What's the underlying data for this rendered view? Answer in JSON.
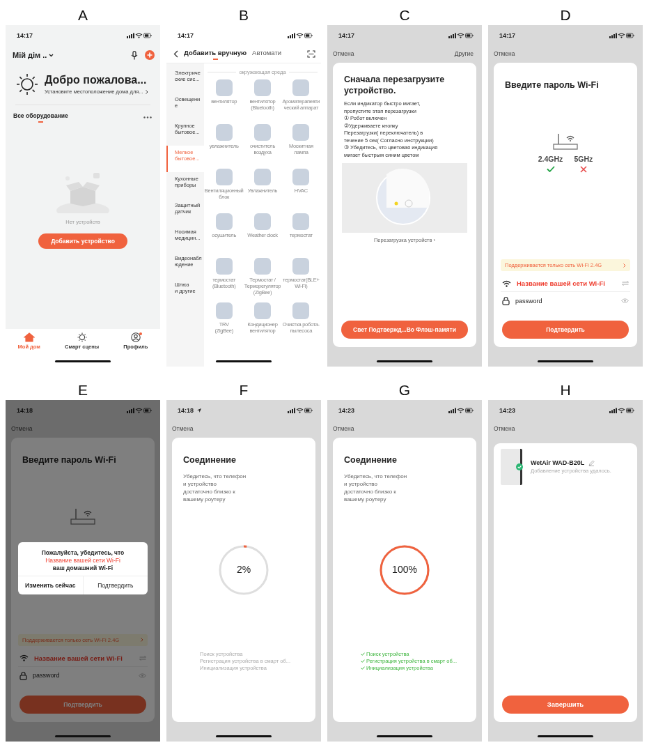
{
  "panels": [
    {
      "label": "A",
      "kind": "home",
      "time": "14:17",
      "home_name": "Мій дім ..",
      "welcome_title": "Добро пожалова...",
      "welcome_subtitle": "Установите местоположение дома для...",
      "section_tab": {
        "label": "Все оборудование",
        "selected": true
      },
      "empty_text": "Нет устройств",
      "add_button": "Добавить устройство",
      "nav": [
        {
          "label": "Мой дом",
          "selected": true,
          "badge": false
        },
        {
          "label": "Смарт сцены",
          "selected": false,
          "badge": false
        },
        {
          "label": "Профиль",
          "selected": false,
          "badge": true
        }
      ]
    },
    {
      "label": "B",
      "kind": "add",
      "time": "14:17",
      "tabs": [
        {
          "label": "Добавить вручную",
          "selected": true
        },
        {
          "label": "Автомати",
          "selected": false
        }
      ],
      "categories": [
        {
          "label": "Электриче\nские сис...",
          "selected": false
        },
        {
          "label": "Освещени\nе",
          "selected": false
        },
        {
          "label": "Крупное\nбытовое...",
          "selected": false
        },
        {
          "label": "Мелкое\nбытовое...",
          "selected": true
        },
        {
          "label": "Кухонные\nприборы",
          "selected": false
        },
        {
          "label": "Защитный\nдатчик",
          "selected": false
        },
        {
          "label": "Носимая\nмедицин...",
          "selected": false
        },
        {
          "label": "Видеонабл\nюдение",
          "selected": false
        },
        {
          "label": "Шлюз\nи другие",
          "selected": false
        }
      ],
      "section": "окружающая среда",
      "devices": [
        "вентилятор",
        "вентилятор\n(Bluetooth)",
        "Ароматерапевти\nческий аппарат",
        "увлажнитель",
        "очиститель\nвоздуха",
        "Москитная\nлампа",
        "Вентиляционный\nблок",
        "Увлажнитель",
        "HVAC",
        "осушитель",
        "Weather clock",
        "термостат",
        "термостат\n(Bluetooth)",
        "Термостат /\nТерморегулятор\n(ZigBee)",
        "термостат(BLE+\nWi-Fi)",
        "TRV\n(ZigBee)",
        "Кондиционер\nвентилятор",
        "Очистка робота-\nпылесоса"
      ]
    },
    {
      "label": "C",
      "kind": "reset",
      "time": "14:17",
      "cancel": "Отмена",
      "other": "Другие",
      "title": "Сначала перезагрузите устройство.",
      "body": "Если индикатор быстро мигает,\nпропустите этап перезагрузки\n① Робот включен\n②Удерживаете кнопку\nПерезагрузки( переключатель) в\nтечение 5 сек( Согласно инструкции)\n③ Убедитесь, что  цветовая индикация\nмигает быстрым синим цветом",
      "link": "Перезагрузка устройств ›",
      "button": "Свет Подтвержд...Во Флэш-памяти"
    },
    {
      "label": "D",
      "kind": "wifi",
      "time": "14:17",
      "cancel": "Отмена",
      "title": "Введите пароль Wi-Fi",
      "bands": [
        {
          "label": "2.4GHz",
          "supported": true
        },
        {
          "label": "5GHz",
          "supported": false
        }
      ],
      "notice": "Поддерживается только сеть Wi-Fi 2.4G",
      "ssid": "Название вашей сети Wi-Fi",
      "password": "password",
      "confirm": "Подтвердить"
    },
    {
      "label": "E",
      "kind": "wifi",
      "time": "14:18",
      "cancel": "Отмена",
      "title": "Введите пароль Wi-Fi",
      "notice": "Поддерживается только сеть Wi-Fi 2.4G",
      "ssid": "Название вашей сети Wi-Fi",
      "password": "password",
      "confirm": "Подтвердить",
      "dialog": {
        "line_1": "Пожалуйста, убедитесь, что",
        "ssid": "Название вашей сети Wi-Fi",
        "line_2": "ваш домашний Wi-Fi",
        "buttons": [
          "Изменить сейчас",
          "Подтвердить"
        ]
      }
    },
    {
      "label": "F",
      "kind": "connecting",
      "time": "14:18",
      "location_on": true,
      "cancel": "Отмена",
      "title": "Соединение",
      "body": "Убедитесь, что телефон\nи устройство\nдостаточно близко к\nвашему роутеру",
      "level": 0.02,
      "reading": "2%",
      "steps": [
        {
          "label": "Поиск устройства",
          "done": false
        },
        {
          "label": "Регистрация устройства в смарт об...",
          "done": false
        },
        {
          "label": "Инициализация устройства",
          "done": false
        }
      ]
    },
    {
      "label": "G",
      "kind": "connecting",
      "time": "14:23",
      "cancel": "Отмена",
      "title": "Соединение",
      "body": "Убедитесь, что телефон\nи устройство\nдостаточно близко к\nвашему роутеру",
      "level": 1,
      "reading": "100%",
      "steps": [
        {
          "label": "Поиск устройства",
          "done": true
        },
        {
          "label": "Регистрация устройства в смарт об...",
          "done": true
        },
        {
          "label": "Инициализация устройства",
          "done": true
        }
      ]
    },
    {
      "label": "H",
      "kind": "done",
      "time": "14:23",
      "cancel": "Отмена",
      "device_name": "WetAir WAD-B20L",
      "status": "Добавление устройства удалось.",
      "button": "Завершить"
    }
  ]
}
